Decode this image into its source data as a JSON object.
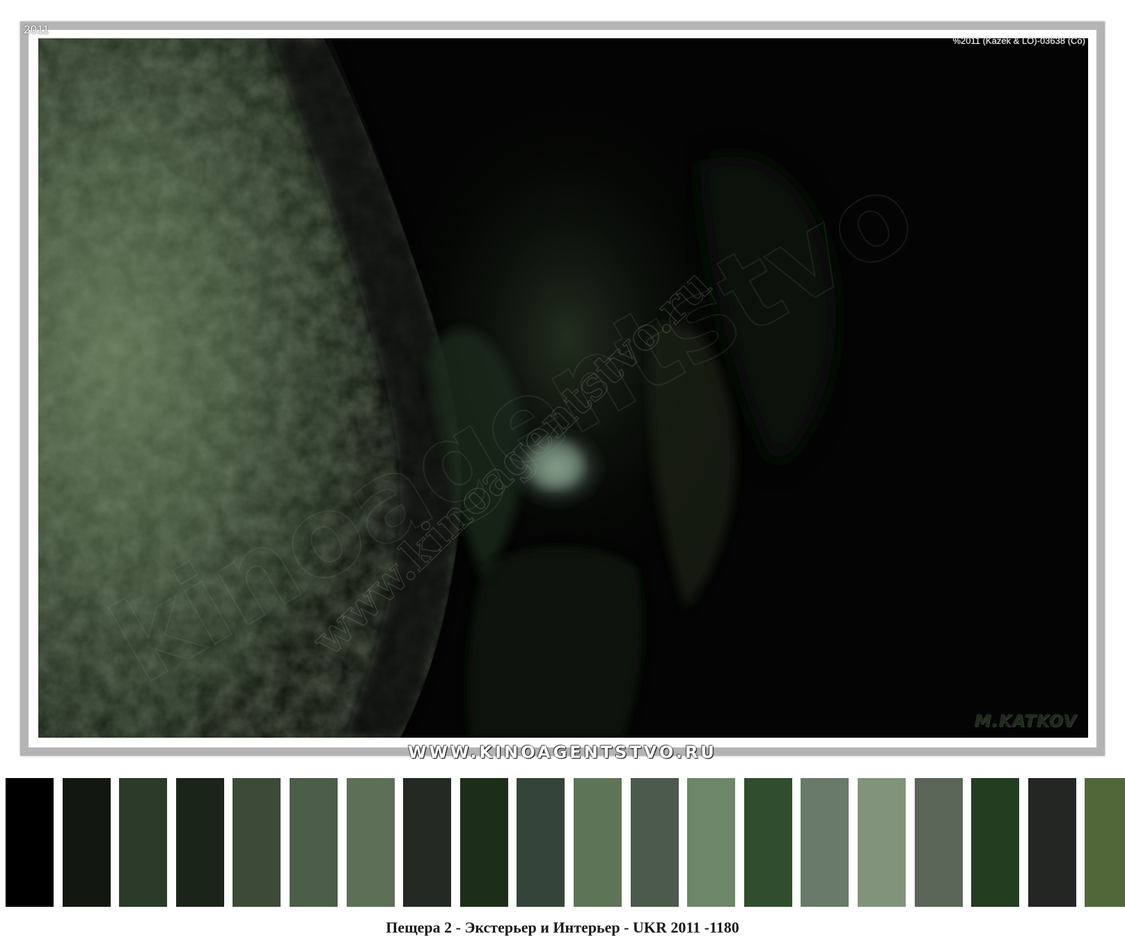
{
  "photo": {
    "year_tag": "2011",
    "copyright": "%2011 (Kazek & LO)-03638 (Co)",
    "author_signature": "M.KATKOV",
    "watermark_diagonal": "www.kinoagentstvo.ru"
  },
  "site_banner": "WWW.KINOAGENTSTVO.RU",
  "palette": [
    "#000000",
    "#121810",
    "#2b3a29",
    "#1b2419",
    "#3c4a36",
    "#4b5e48",
    "#5c7057",
    "#232a24",
    "#1d2e18",
    "#344439",
    "#5d7556",
    "#4b5a4c",
    "#6d8669",
    "#304e2e",
    "#69796a",
    "#7f947a",
    "#5a6558",
    "#233d20",
    "#242624",
    "#4f6739"
  ],
  "caption": "Пещера 2 - Экстерьер и Интерьер - UKR 2011 -1180"
}
